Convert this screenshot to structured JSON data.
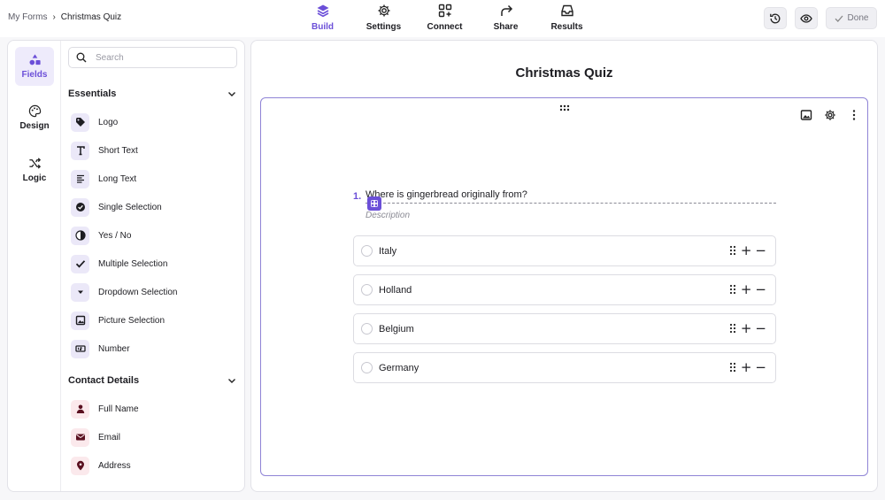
{
  "breadcrumb": {
    "root": "My Forms",
    "current": "Christmas Quiz"
  },
  "nav": [
    {
      "label": "Build",
      "icon": "layers-icon"
    },
    {
      "label": "Settings",
      "icon": "gear-icon"
    },
    {
      "label": "Connect",
      "icon": "connect-icon"
    },
    {
      "label": "Share",
      "icon": "share-icon"
    },
    {
      "label": "Results",
      "icon": "inbox-icon"
    }
  ],
  "actions": {
    "done_label": "Done"
  },
  "rail": [
    {
      "label": "Fields"
    },
    {
      "label": "Design"
    },
    {
      "label": "Logic"
    }
  ],
  "search": {
    "placeholder": "Search"
  },
  "sections": {
    "essentials": {
      "title": "Essentials",
      "items": [
        {
          "label": "Logo"
        },
        {
          "label": "Short Text"
        },
        {
          "label": "Long Text"
        },
        {
          "label": "Single Selection"
        },
        {
          "label": "Yes / No"
        },
        {
          "label": "Multiple Selection"
        },
        {
          "label": "Dropdown Selection"
        },
        {
          "label": "Picture Selection"
        },
        {
          "label": "Number"
        }
      ]
    },
    "contact": {
      "title": "Contact Details",
      "items": [
        {
          "label": "Full Name"
        },
        {
          "label": "Email"
        },
        {
          "label": "Address"
        }
      ]
    }
  },
  "form": {
    "title": "Christmas Quiz",
    "question": {
      "number": "1.",
      "text": "Where is gingerbread originally from?",
      "description_placeholder": "Description",
      "options": [
        {
          "label": "Italy"
        },
        {
          "label": "Holland"
        },
        {
          "label": "Belgium"
        },
        {
          "label": "Germany"
        }
      ]
    }
  },
  "colors": {
    "accent": "#6b4fd8",
    "accent_soft": "#eeebfb",
    "contact_icon": "#5a1020"
  }
}
